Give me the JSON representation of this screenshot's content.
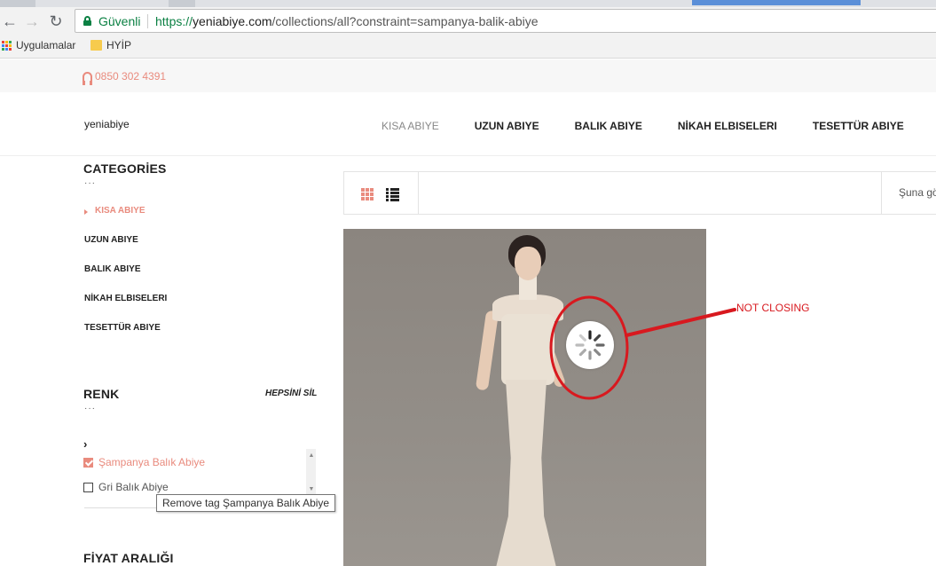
{
  "browser": {
    "security_label": "Güvenli",
    "url_scheme": "https://",
    "url_host": "yeniabiye.com",
    "url_path": "/collections/all?constraint=sampanya-balik-abiye",
    "bookmarks": [
      "Uygulamalar",
      "HYİP"
    ]
  },
  "site": {
    "phone": "0850 302 4391",
    "logo": "yeniabiye",
    "nav": [
      "KISA ABIYE",
      "UZUN ABIYE",
      "BALIK ABIYE",
      "NİKAH ELBISELERI",
      "TESETTÜR ABIYE"
    ]
  },
  "sidebar": {
    "categories_title": "CATEGORİES",
    "categories": [
      "KISA ABIYE",
      "UZUN ABIYE",
      "BALIK ABIYE",
      "NİKAH ELBISELERI",
      "TESETTÜR ABIYE"
    ],
    "renk_title": "RENK",
    "clear_all": "HEPSİNİ SİL",
    "colors": [
      {
        "label": "Şampanya Balık Abiye",
        "checked": true
      },
      {
        "label": "Gri Balık Abiye",
        "checked": false
      }
    ],
    "tooltip": "Remove tag Şampanya Balık Abiye",
    "price_title": "FİYAT ARALIĞI"
  },
  "toolbar": {
    "sort_label": "Şuna gö"
  },
  "annotation": {
    "text": "NOT CLOSING",
    "color": "#d8191f"
  },
  "colors": {
    "accent": "#e98b7e",
    "secure_green": "#0b8043"
  }
}
